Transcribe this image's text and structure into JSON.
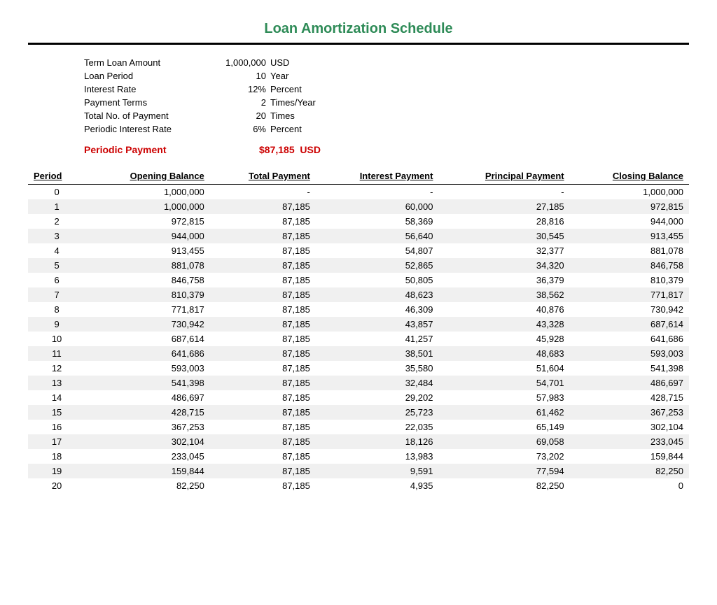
{
  "title": "Loan Amortization Schedule",
  "summary": {
    "rows": [
      {
        "label": "Term Loan Amount",
        "value": "1,000,000",
        "unit": "USD"
      },
      {
        "label": "Loan Period",
        "value": "10",
        "unit": "Year"
      },
      {
        "label": "Interest Rate",
        "value": "12%",
        "unit": "Percent"
      },
      {
        "label": "Payment Terms",
        "value": "2",
        "unit": "Times/Year"
      },
      {
        "label": "Total No. of Payment",
        "value": "20",
        "unit": "Times"
      },
      {
        "label": "Periodic Interest Rate",
        "value": "6%",
        "unit": "Percent"
      }
    ],
    "periodic_payment_label": "Periodic Payment",
    "periodic_payment_value": "$87,185",
    "periodic_payment_unit": "USD"
  },
  "table": {
    "headers": [
      "Period",
      "Opening Balance",
      "Total Payment",
      "Interest Payment",
      "Principal Payment",
      "Closing Balance"
    ],
    "rows": [
      [
        "0",
        "1,000,000",
        "-",
        "-",
        "-",
        "1,000,000"
      ],
      [
        "1",
        "1,000,000",
        "87,185",
        "60,000",
        "27,185",
        "972,815"
      ],
      [
        "2",
        "972,815",
        "87,185",
        "58,369",
        "28,816",
        "944,000"
      ],
      [
        "3",
        "944,000",
        "87,185",
        "56,640",
        "30,545",
        "913,455"
      ],
      [
        "4",
        "913,455",
        "87,185",
        "54,807",
        "32,377",
        "881,078"
      ],
      [
        "5",
        "881,078",
        "87,185",
        "52,865",
        "34,320",
        "846,758"
      ],
      [
        "6",
        "846,758",
        "87,185",
        "50,805",
        "36,379",
        "810,379"
      ],
      [
        "7",
        "810,379",
        "87,185",
        "48,623",
        "38,562",
        "771,817"
      ],
      [
        "8",
        "771,817",
        "87,185",
        "46,309",
        "40,876",
        "730,942"
      ],
      [
        "9",
        "730,942",
        "87,185",
        "43,857",
        "43,328",
        "687,614"
      ],
      [
        "10",
        "687,614",
        "87,185",
        "41,257",
        "45,928",
        "641,686"
      ],
      [
        "11",
        "641,686",
        "87,185",
        "38,501",
        "48,683",
        "593,003"
      ],
      [
        "12",
        "593,003",
        "87,185",
        "35,580",
        "51,604",
        "541,398"
      ],
      [
        "13",
        "541,398",
        "87,185",
        "32,484",
        "54,701",
        "486,697"
      ],
      [
        "14",
        "486,697",
        "87,185",
        "29,202",
        "57,983",
        "428,715"
      ],
      [
        "15",
        "428,715",
        "87,185",
        "25,723",
        "61,462",
        "367,253"
      ],
      [
        "16",
        "367,253",
        "87,185",
        "22,035",
        "65,149",
        "302,104"
      ],
      [
        "17",
        "302,104",
        "87,185",
        "18,126",
        "69,058",
        "233,045"
      ],
      [
        "18",
        "233,045",
        "87,185",
        "13,983",
        "73,202",
        "159,844"
      ],
      [
        "19",
        "159,844",
        "87,185",
        "9,591",
        "77,594",
        "82,250"
      ],
      [
        "20",
        "82,250",
        "87,185",
        "4,935",
        "82,250",
        "0"
      ]
    ]
  }
}
